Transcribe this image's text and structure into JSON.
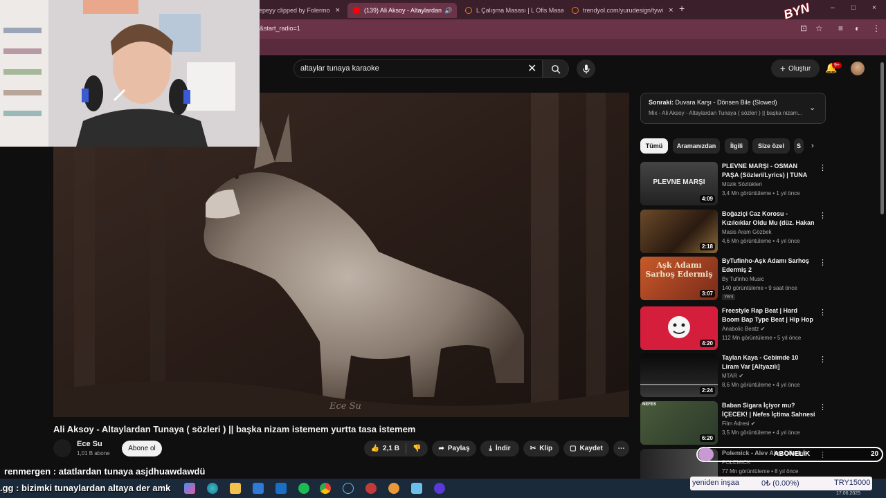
{
  "browser": {
    "tabs": [
      {
        "label": "epeyy clipped by Folermo",
        "icon_color": "#9d7b88"
      },
      {
        "label": "(139) Ali Aksoy - Altaylardan",
        "icon_color": "#ff0000",
        "active": true
      },
      {
        "label": "L Çalışma Masası | L Ofis Masası",
        "icon_color": "#f27a1a"
      },
      {
        "label": "trendyol.com/yurudesign/tywi",
        "icon_color": "#f27a1a"
      }
    ],
    "new_tab": "+",
    "address": "&start_radio=1",
    "window_controls": [
      "–",
      "□",
      "×"
    ],
    "brand_logo_text": "BYN"
  },
  "youtube": {
    "search_value": "altaylar tunaya karaoke",
    "create_label": "Oluştur",
    "notifications_badge": "9+"
  },
  "video": {
    "watermark": "Ece Su",
    "title": "Ali Aksoy - Altaylardan Tunaya ( sözleri ) || başka nizam istemem yurtta tasa istemem",
    "channel": "Ece Su",
    "subscribers": "1,01 B abone",
    "subscribe_label": "Abone ol",
    "likes": "2,1 B",
    "share_label": "Paylaş",
    "download_label": "İndir",
    "clip_label": "Klip",
    "save_label": "Kaydet"
  },
  "sidebar": {
    "next_label": "Sonraki:",
    "next_title": "Duvara Karşı - Dönsen Bile (Slowed)",
    "next_subtitle": "Mix - Ali Aksoy - Altaylardan Tunaya ( sözleri ) || başka nizam...",
    "chips": [
      "Tümü",
      "Aramanızdan",
      "İlgili",
      "Size özel",
      "S"
    ],
    "recommendations": [
      {
        "title": "PLEVNE MARŞI - OSMAN PAŞA (Sözleri/Lyrics) | TUNA NEHRİ ...",
        "channel": "Müzik Sözlükleri",
        "meta": "3,4 Mn görüntüleme • 1 yıl önce",
        "duration": "4:09",
        "thumb_text": "PLEVNE MARŞI"
      },
      {
        "title": "Boğaziçi Caz Korosu - Kızılcıklar Oldu Mu (düz. Hakan Önsöz)",
        "channel": "Masis Aram Gözbek",
        "meta": "4,6 Mn görüntüleme • 4 yıl önce",
        "duration": "2:18",
        "thumb_text": ""
      },
      {
        "title": "ByTufinho-Aşk Adamı Sarhoş Edermiş 2",
        "channel": "By Tufinho Music",
        "meta": "140 görüntüleme • 9 saat önce",
        "duration": "3:07",
        "badge": "Yeni",
        "thumb_text": "Aşk Adamı Sarhoş Edermiş"
      },
      {
        "title": "Freestyle Rap Beat | Hard Boom Bap Type Beat | Hip Hop ...",
        "channel": "Anabolic Beatz",
        "meta": "112 Mn görüntüleme • 5 yıl önce",
        "duration": "4:20",
        "thumb_text": ""
      },
      {
        "title": "Taylan Kaya - Cebimde 10 Liram Var [Altyazılı]",
        "channel": "MTAR",
        "meta": "8,6 Mn görüntüleme • 4 yıl önce",
        "duration": "2:24",
        "thumb_text": ""
      },
      {
        "title": "Baban Sigara İçiyor mu? İÇECEK! | Nefes İçtima Sahnesi",
        "channel": "Film Adresi",
        "meta": "3,5 Mn görüntüleme • 4 yıl önce",
        "duration": "6:20",
        "thumb_text": "NEFES"
      },
      {
        "title": "Polemick - Alev Alev Dilerim",
        "channel": "POLEMICK",
        "meta": "77 Mn görüntüleme • 8 yıl önce",
        "duration": "",
        "thumb_text": ""
      }
    ]
  },
  "stream": {
    "chat_line_1": "renmergen : atatlardan tunaya asjdhuawdawdü",
    "chat_line_2": ".gg : bizimki tunaylardan altaya der amk",
    "subscriber_widget": {
      "label": "ABONELİK",
      "count": "20"
    },
    "goal": {
      "name": "yeniden inşaa",
      "amount": "0₺ (0.00%)",
      "target": "TRY15000"
    },
    "date": "17.06.2025"
  },
  "colors": {
    "youtube_red": "#ff0000",
    "background": "#0f0f0f",
    "chrome": "#6b3348"
  }
}
